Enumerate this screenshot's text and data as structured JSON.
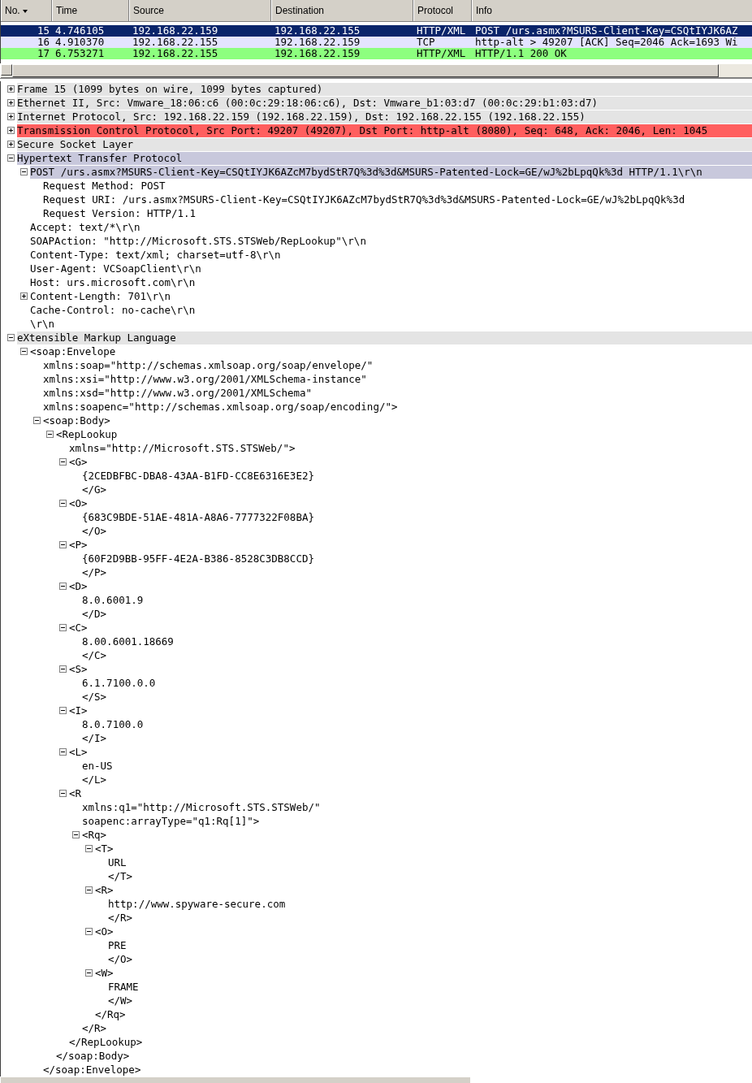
{
  "packet_list": {
    "columns": [
      "No.",
      "Time",
      "Source",
      "Destination",
      "Protocol",
      "Info"
    ],
    "rows": [
      {
        "cells": [
          "15",
          "4.746105",
          "192.168.22.159",
          "192.168.22.155",
          "HTTP/XML",
          "POST /urs.asmx?MSURS-Client-Key=CSQtIYJK6AZ"
        ],
        "selected": true
      },
      {
        "cells": [
          "16",
          "4.910370",
          "192.168.22.155",
          "192.168.22.159",
          "TCP",
          "http-alt > 49207 [ACK] Seq=2046 Ack=1693 Wi"
        ],
        "selected": false,
        "color": "#e4e4ff"
      },
      {
        "cells": [
          "17",
          "6.753271",
          "192.168.22.155",
          "192.168.22.159",
          "HTTP/XML",
          "HTTP/1.1 200 OK"
        ],
        "selected": false,
        "color": "#8dff7f"
      }
    ]
  },
  "details": [
    {
      "text": "Frame 15 (1099 bytes on wire, 1099 bytes captured)",
      "expanded": false,
      "color": "#e4e4e4"
    },
    {
      "text": "Ethernet II, Src: Vmware_18:06:c6 (00:0c:29:18:06:c6), Dst: Vmware_b1:03:d7 (00:0c:29:b1:03:d7)",
      "expanded": false,
      "color": "#e4e4e4"
    },
    {
      "text": "Internet Protocol, Src: 192.168.22.159 (192.168.22.159), Dst: 192.168.22.155 (192.168.22.155)",
      "expanded": false,
      "color": "#e4e4e4"
    },
    {
      "text": "Transmission Control Protocol, Src Port: 49207 (49207), Dst Port: http-alt (8080), Seq: 648, Ack: 2046, Len: 1045",
      "expanded": false,
      "color": "#ff5f5f"
    },
    {
      "text": "Secure Socket Layer",
      "expanded": false,
      "color": "#e4e4e4"
    },
    {
      "text": "Hypertext Transfer Protocol",
      "expanded": true,
      "color": "#c8c8dc",
      "children": [
        {
          "text": "POST /urs.asmx?MSURS-Client-Key=CSQtIYJK6AZcM7bydStR7Q%3d%3d&MSURS-Patented-Lock=GE/wJ%2bLpqQk%3d HTTP/1.1\\r\\n",
          "expanded": true,
          "color": "#c8c8dc",
          "children": [
            {
              "text": "Request Method: POST"
            },
            {
              "text": "Request URI: /urs.asmx?MSURS-Client-Key=CSQtIYJK6AZcM7bydStR7Q%3d%3d&MSURS-Patented-Lock=GE/wJ%2bLpqQk%3d"
            },
            {
              "text": "Request Version: HTTP/1.1"
            }
          ]
        },
        {
          "text": "Accept: text/*\\r\\n"
        },
        {
          "text": "SOAPAction: \"http://Microsoft.STS.STSWeb/RepLookup\"\\r\\n"
        },
        {
          "text": "Content-Type: text/xml; charset=utf-8\\r\\n"
        },
        {
          "text": "User-Agent: VCSoapClient\\r\\n"
        },
        {
          "text": "Host: urs.microsoft.com\\r\\n"
        },
        {
          "text": "Content-Length: 701\\r\\n",
          "expanded": false
        },
        {
          "text": "Cache-Control: no-cache\\r\\n"
        },
        {
          "text": "\\r\\n"
        }
      ]
    },
    {
      "text": "eXtensible Markup Language",
      "expanded": true,
      "color": "#e4e4e4",
      "children": [
        {
          "text": "<soap:Envelope",
          "expanded": true,
          "children": [
            {
              "text": "xmlns:soap=\"http://schemas.xmlsoap.org/soap/envelope/\""
            },
            {
              "text": "xmlns:xsi=\"http://www.w3.org/2001/XMLSchema-instance\""
            },
            {
              "text": "xmlns:xsd=\"http://www.w3.org/2001/XMLSchema\""
            },
            {
              "text": "xmlns:soapenc=\"http://schemas.xmlsoap.org/soap/encoding/\">"
            },
            {
              "text": "<soap:Body>",
              "expanded": true,
              "children": [
                {
                  "text": "<RepLookup",
                  "expanded": true,
                  "children": [
                    {
                      "text": "xmlns=\"http://Microsoft.STS.STSWeb/\">"
                    },
                    {
                      "text": "<G>",
                      "expanded": true,
                      "children": [
                        {
                          "text": "{2CEDBFBC-DBA8-43AA-B1FD-CC8E6316E3E2}"
                        },
                        {
                          "text": "</G>"
                        }
                      ]
                    },
                    {
                      "text": "<O>",
                      "expanded": true,
                      "children": [
                        {
                          "text": "{683C9BDE-51AE-481A-A8A6-7777322F08BA}"
                        },
                        {
                          "text": "</O>"
                        }
                      ]
                    },
                    {
                      "text": "<P>",
                      "expanded": true,
                      "children": [
                        {
                          "text": "{60F2D9BB-95FF-4E2A-B386-8528C3DB8CCD}"
                        },
                        {
                          "text": "</P>"
                        }
                      ]
                    },
                    {
                      "text": "<D>",
                      "expanded": true,
                      "children": [
                        {
                          "text": "8.0.6001.9"
                        },
                        {
                          "text": "</D>"
                        }
                      ]
                    },
                    {
                      "text": "<C>",
                      "expanded": true,
                      "children": [
                        {
                          "text": "8.00.6001.18669"
                        },
                        {
                          "text": "</C>"
                        }
                      ]
                    },
                    {
                      "text": "<S>",
                      "expanded": true,
                      "children": [
                        {
                          "text": "6.1.7100.0.0"
                        },
                        {
                          "text": "</S>"
                        }
                      ]
                    },
                    {
                      "text": "<I>",
                      "expanded": true,
                      "children": [
                        {
                          "text": "8.0.7100.0"
                        },
                        {
                          "text": "</I>"
                        }
                      ]
                    },
                    {
                      "text": "<L>",
                      "expanded": true,
                      "children": [
                        {
                          "text": "en-US"
                        },
                        {
                          "text": "</L>"
                        }
                      ]
                    },
                    {
                      "text": "<R",
                      "expanded": true,
                      "children": [
                        {
                          "text": "xmlns:q1=\"http://Microsoft.STS.STSWeb/\""
                        },
                        {
                          "text": "soapenc:arrayType=\"q1:Rq[1]\">"
                        },
                        {
                          "text": "<Rq>",
                          "expanded": true,
                          "children": [
                            {
                              "text": "<T>",
                              "expanded": true,
                              "children": [
                                {
                                  "text": "URL"
                                },
                                {
                                  "text": "</T>"
                                }
                              ]
                            },
                            {
                              "text": "<R>",
                              "expanded": true,
                              "children": [
                                {
                                  "text": "http://www.spyware-secure.com"
                                },
                                {
                                  "text": "</R>"
                                }
                              ]
                            },
                            {
                              "text": "<O>",
                              "expanded": true,
                              "children": [
                                {
                                  "text": "PRE"
                                },
                                {
                                  "text": "</O>"
                                }
                              ]
                            },
                            {
                              "text": "<W>",
                              "expanded": true,
                              "children": [
                                {
                                  "text": "FRAME"
                                },
                                {
                                  "text": "</W>"
                                }
                              ]
                            },
                            {
                              "text": "</Rq>"
                            }
                          ]
                        },
                        {
                          "text": "</R>"
                        }
                      ]
                    },
                    {
                      "text": "</RepLookup>"
                    }
                  ]
                },
                {
                  "text": "</soap:Body>"
                }
              ]
            },
            {
              "text": "</soap:Envelope>"
            }
          ]
        }
      ]
    }
  ]
}
